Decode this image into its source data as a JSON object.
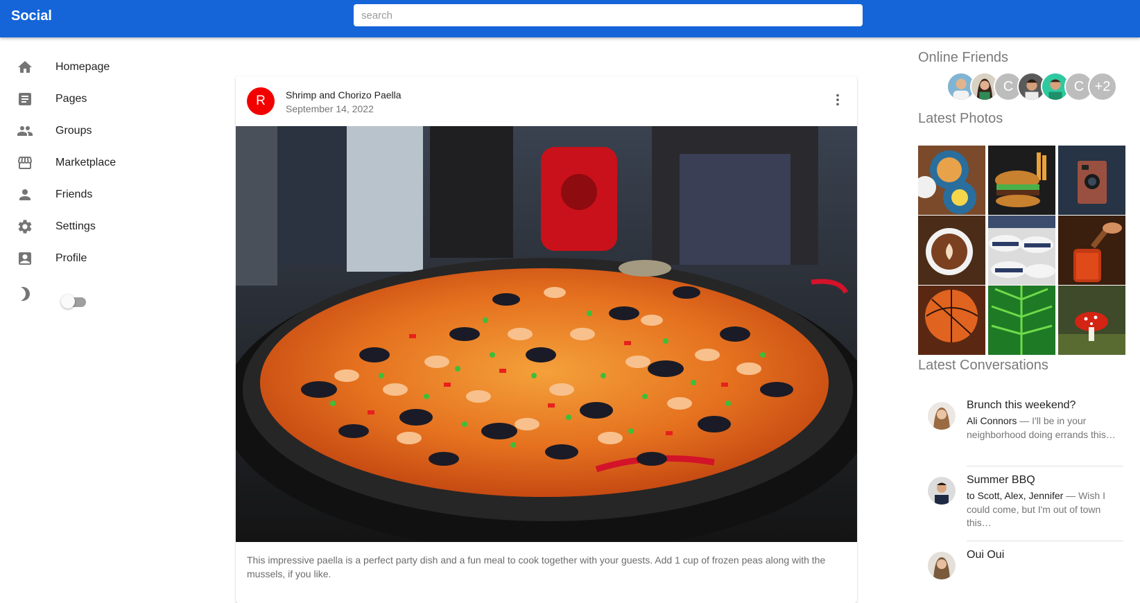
{
  "app": {
    "title": "Social"
  },
  "search": {
    "placeholder": "search"
  },
  "sidebar": {
    "items": [
      {
        "label": "Homepage",
        "icon": "home-icon"
      },
      {
        "label": "Pages",
        "icon": "article-icon"
      },
      {
        "label": "Groups",
        "icon": "groups-icon"
      },
      {
        "label": "Marketplace",
        "icon": "storefront-icon"
      },
      {
        "label": "Friends",
        "icon": "person-icon"
      },
      {
        "label": "Settings",
        "icon": "gear-icon"
      },
      {
        "label": "Profile",
        "icon": "account-box-icon"
      }
    ],
    "dark_mode": {
      "icon": "moon-icon",
      "enabled": false
    }
  },
  "post": {
    "avatar_letter": "R",
    "title": "Shrimp and Chorizo Paella",
    "date": "September 14, 2022",
    "image": "paella-photo",
    "text": "This impressive paella is a perfect party dish and a fun meal to cook together with your guests. Add 1 cup of frozen peas along with the mussels, if you like.",
    "colors": {
      "avatar": "#f20000"
    }
  },
  "right": {
    "online_friends_title": "Online Friends",
    "online_friends": [
      {
        "type": "photo",
        "name": "friend-1"
      },
      {
        "type": "photo",
        "name": "friend-2"
      },
      {
        "type": "letter",
        "letter": "C"
      },
      {
        "type": "photo",
        "name": "friend-4"
      },
      {
        "type": "photo",
        "name": "friend-5"
      },
      {
        "type": "letter",
        "letter": "C"
      },
      {
        "type": "more",
        "label": "+2"
      }
    ],
    "latest_photos_title": "Latest Photos",
    "latest_photos": [
      "breakfast",
      "burger",
      "camera",
      "coffee",
      "hats",
      "honey",
      "basketball",
      "fern",
      "mushroom"
    ],
    "latest_conversations_title": "Latest Conversations",
    "conversations": [
      {
        "title": "Brunch this weekend?",
        "who": "Ali Connors",
        "text": " — I'll be in your neighborhood doing errands this…"
      },
      {
        "title": "Summer BBQ",
        "who": "to Scott, Alex, Jennifer",
        "text": " — Wish I could come, but I'm out of town this…"
      },
      {
        "title": "Oui Oui",
        "who": "",
        "text": ""
      }
    ]
  },
  "colors": {
    "appbar": "#1565d8"
  }
}
